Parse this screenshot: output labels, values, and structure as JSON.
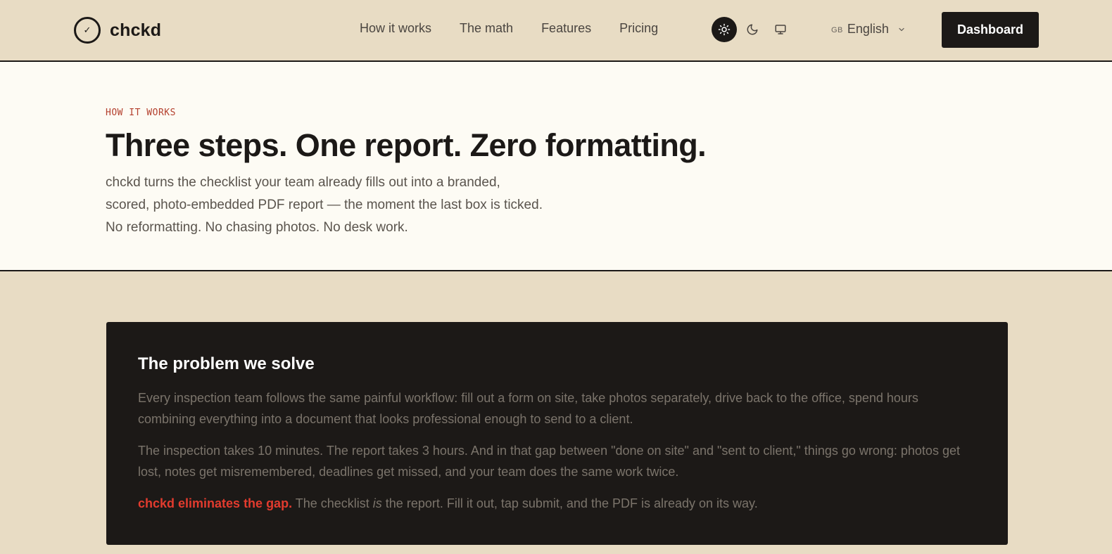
{
  "brand": {
    "name": "chckd",
    "mark": "✓"
  },
  "nav": [
    "How it works",
    "The math",
    "Features",
    "Pricing"
  ],
  "theme_toggle": {
    "options": [
      "sun-icon",
      "moon-icon",
      "monitor-icon"
    ],
    "active": "sun-icon"
  },
  "language": {
    "code": "GB",
    "label": "English"
  },
  "dashboard_button": "Dashboard",
  "hero": {
    "eyebrow": "HOW IT WORKS",
    "title": "Three steps. One report. Zero formatting.",
    "lines": [
      "chckd turns the checklist your team already fills out into a branded,",
      "scored, photo-embedded PDF report — the moment the last box is ticked.",
      "No reformatting. No chasing photos. No desk work."
    ]
  },
  "problem": {
    "title": "The problem we solve",
    "p1": "Every inspection team follows the same painful workflow: fill out a form on site, take photos separately, drive back to the office, spend hours combining everything into a document that looks professional enough to send to a client.",
    "p2": "The inspection takes 10 minutes. The report takes 3 hours. And in that gap between \"done on site\" and \"sent to client,\" things go wrong: photos get lost, notes get misremembered, deadlines get missed, and your team does the same work twice.",
    "p3_highlight": "chckd eliminates the gap.",
    "p3_a": " The checklist ",
    "p3_em": "is",
    "p3_b": " the report. Fill it out, tap submit, and the PDF is already on its way."
  },
  "colors": {
    "accent": "#e23b2e",
    "eyebrow": "#b4402e",
    "background": "#e8dcc4",
    "hero_bg": "#fdfbf4",
    "dark": "#1c1917"
  }
}
